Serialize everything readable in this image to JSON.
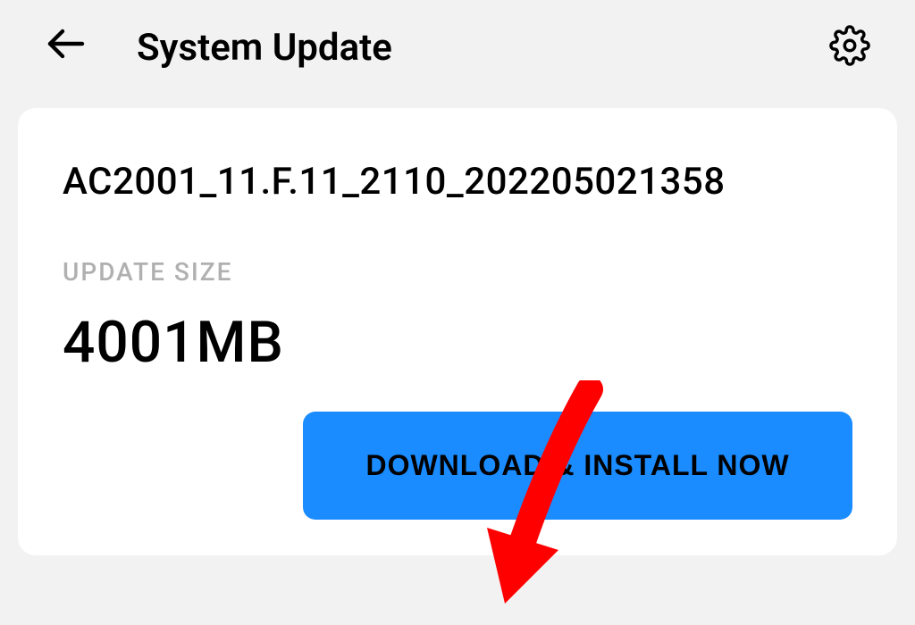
{
  "header": {
    "title": "System Update"
  },
  "update": {
    "version": "AC2001_11.F.11_2110_202205021358",
    "size_label": "UPDATE SIZE",
    "size_value": "4001MB",
    "download_button_label": "DOWNLOAD & INSTALL NOW"
  }
}
